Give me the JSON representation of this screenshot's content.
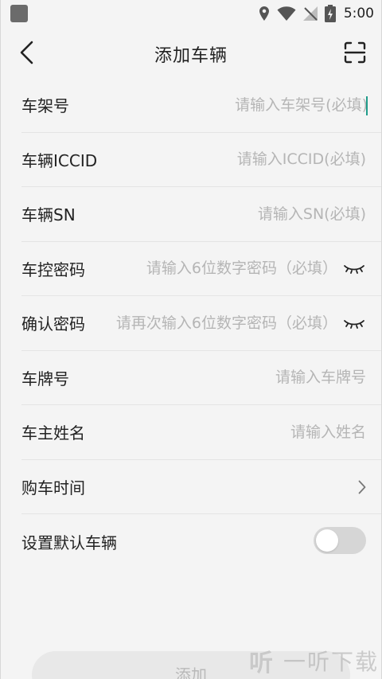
{
  "status_bar": {
    "time": "5:00"
  },
  "header": {
    "title": "添加车辆"
  },
  "form": {
    "rows": [
      {
        "label": "车架号",
        "placeholder": "请输入车架号(必填)",
        "value": ""
      },
      {
        "label": "车辆ICCID",
        "placeholder": "请输入ICCID(必填)",
        "value": ""
      },
      {
        "label": "车辆SN",
        "placeholder": "请输入SN(必填)",
        "value": ""
      },
      {
        "label": "车控密码",
        "placeholder": "请输入6位数字密码（必填）",
        "value": ""
      },
      {
        "label": "确认密码",
        "placeholder": "请再次输入6位数字密码（必填）",
        "value": ""
      },
      {
        "label": "车牌号",
        "placeholder": "请输入车牌号",
        "value": ""
      },
      {
        "label": "车主姓名",
        "placeholder": "请输入姓名",
        "value": ""
      },
      {
        "label": "购车时间"
      },
      {
        "label": "设置默认车辆",
        "toggle_on": false
      }
    ]
  },
  "submit": {
    "label": "添加"
  },
  "watermark": {
    "logo": "听",
    "text": "一听下载"
  },
  "colors": {
    "background": "#f4f4f4",
    "text": "#222222",
    "placeholder": "#b5b5b5",
    "divider": "#e4e4e4",
    "toggle_off": "#d6d6d6",
    "button_disabled": "#e8e8e8",
    "cursor": "#1f9c8a"
  },
  "icons": {
    "back": "arrow-back-icon",
    "scan": "scan-icon",
    "eye_closed": "eye-closed-icon",
    "chevron": "chevron-right-icon"
  }
}
